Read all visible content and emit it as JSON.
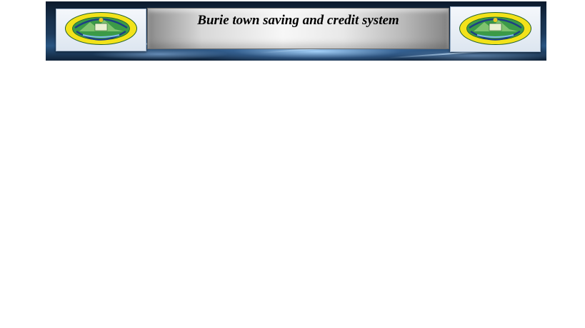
{
  "header": {
    "title": "Burie town saving and credit system",
    "logo_left": {
      "icon": "university-seal-icon"
    },
    "logo_right": {
      "icon": "university-seal-icon"
    }
  },
  "colors": {
    "banner_dark": "#0c1a2c",
    "banner_glow": "#aad7ff",
    "seal_yellow": "#f2e21a",
    "seal_green": "#2f8b3c",
    "title_text": "#000000"
  }
}
